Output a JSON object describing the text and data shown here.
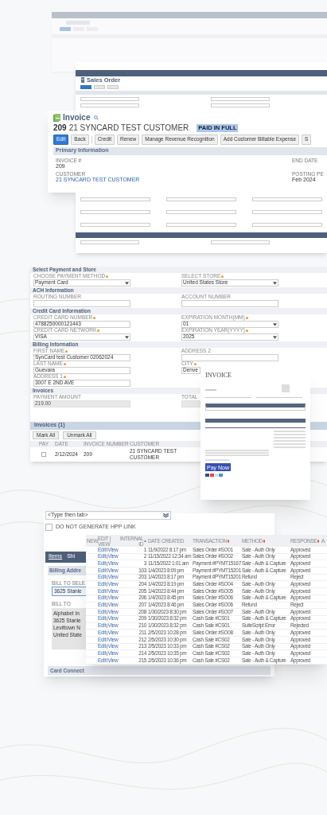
{
  "sales_order": {
    "title": "Sales Order"
  },
  "invoice": {
    "title": "Invoice",
    "number": "209",
    "customer": "21 SYNCARD TEST CUSTOMER",
    "status": "PAID IN FULL",
    "buttons": [
      {
        "label": "Edit",
        "primary": true
      },
      {
        "label": "Back",
        "primary": false
      },
      {
        "label": "Credit",
        "primary": false
      },
      {
        "label": "Renew",
        "primary": false
      },
      {
        "label": "Manage Revenue Recognition",
        "primary": false
      },
      {
        "label": "Add Customer Billable Expense",
        "primary": false
      },
      {
        "label": "S",
        "primary": false
      }
    ],
    "section": "Primary Information",
    "fields": [
      {
        "label": "INVOICE #",
        "value": "209",
        "link": false
      },
      {
        "label": "END DATE"
      },
      {
        "label": "CUSTOMER",
        "value": "21 SYNCARD TEST CUSTOMER",
        "link": true
      },
      {
        "label": "POSTING PE",
        "value": "Feb 2024",
        "link": false
      }
    ]
  },
  "payment_form": {
    "sections": [
      {
        "title": "Select Payment and Store",
        "fields": [
          {
            "label": "CHOOSE PAYMENT METHOD",
            "required": true,
            "value": "Payment Card",
            "kind": "select"
          },
          {
            "label": "SELECT STORE",
            "required": true,
            "value": "United States Store",
            "kind": "select"
          }
        ]
      },
      {
        "title": "ACH Information",
        "fields": [
          {
            "label": "ROUTING NUMBER",
            "required": false,
            "kind": "input"
          },
          {
            "label": "ACCOUNT NUMBER",
            "required": false,
            "kind": "input"
          }
        ]
      },
      {
        "title": "Credit Card Information",
        "fields": [
          {
            "label": "CREDIT CARD NUMBER",
            "required": true,
            "value": "4788250000121443",
            "kind": "input"
          },
          {
            "label": "EXPIRATION MONTH(MM)",
            "required": true,
            "value": "01",
            "kind": "select"
          },
          {
            "label": "CREDIT CARD NETWORK",
            "required": true,
            "value": "VISA",
            "kind": "select"
          },
          {
            "label": "EXPIRATION YEAR(YYYY)",
            "required": true,
            "value": "2025",
            "kind": "select"
          }
        ]
      },
      {
        "title": "Billing Information",
        "fields": [
          {
            "label": "FIRST NAME",
            "required": true,
            "value": "SynCard test Customer 02062024",
            "kind": "input"
          },
          {
            "label": "ADDRESS 2",
            "required": false,
            "kind": "input"
          },
          {
            "label": "LAST NAME",
            "required": true,
            "value": "Guevara",
            "kind": "input"
          },
          {
            "label": "CITY",
            "required": true,
            "value": "Denve",
            "kind": "input"
          },
          {
            "label": "ADDRESS 1",
            "required": true,
            "value": "3007 E 2ND AVE",
            "kind": "input"
          }
        ]
      },
      {
        "title": "Invoices",
        "fields": [
          {
            "label": "PAYMENT AMOUNT",
            "required": false,
            "value": "219.00",
            "kind": "disabled"
          },
          {
            "label": "TOTAL",
            "kind": "disabled"
          }
        ]
      }
    ],
    "invoices": {
      "title": "Invoices (1)",
      "buttons": [
        "Mark All",
        "Unmark All"
      ],
      "columns": [
        "PAY",
        "DATE",
        "INVOICE NUMBER",
        "CUSTOMER"
      ],
      "rows": [
        {
          "checked": false,
          "cells": [
            null,
            "2/12/2024",
            "209",
            "21 SYNCARD TEST CUSTOMER"
          ]
        }
      ]
    }
  },
  "invoice_document": {
    "title": "INVOICE",
    "pay_button": "Pay Now"
  },
  "bottom_form": {
    "select_placeholder": "<Type then tab>",
    "checkbox": {
      "label": "DO NOT GENERATE HPP LINK",
      "checked": false
    },
    "tabs": [
      {
        "label": "Items",
        "selected": true
      },
      {
        "label": "Shi",
        "selected": false
      }
    ],
    "section": "Billing Addre",
    "bill_to_select_label": "BILL TO SELE",
    "bill_to_select_value": "3625 Stanle",
    "bill_to_label": "BILL TO",
    "bill_to_lines": [
      "Alphabet In",
      "3625 Stanle",
      "Levittown N",
      "United State"
    ],
    "footer_section": "Card Connect"
  },
  "log_table": {
    "columns": [
      "NEW",
      "EDIT | VIEW",
      "INTERNAL ID",
      "DATE CREATED",
      "TRANSACTION",
      "METHOD",
      "RESPONSE",
      "A"
    ],
    "rows": [
      {
        "cells": [
          null,
          {
            "links": [
              "Edit",
              "View"
            ]
          },
          "1",
          "11/9/2022 8:17 pm",
          "Sales Order #SO01",
          "Sale - Auth Only",
          "Approved"
        ]
      },
      {
        "cells": [
          null,
          {
            "links": [
              "Edit",
              "View"
            ]
          },
          "2",
          "11/15/2022 12:34 am",
          "Sales Order #SO02",
          "Sale - Auth Only",
          "Approved"
        ]
      },
      {
        "cells": [
          null,
          {
            "links": [
              "Edit",
              "View"
            ]
          },
          "3",
          "11/15/2022 1:01 am",
          "Payment #PYMT15167",
          "Sale - Auth & Capture",
          "Approved"
        ]
      },
      {
        "cells": [
          null,
          {
            "links": [
              "Edit",
              "View"
            ]
          },
          "103",
          "1/4/2023 8:09 pm",
          "Payment #PYMT15201",
          "Sale - Auth & Capture",
          "Approved"
        ]
      },
      {
        "cells": [
          null,
          {
            "links": [
              "Edit",
              "View"
            ]
          },
          "203",
          "1/4/2023 8:17 pm",
          "Payment #PYMT15201",
          "Refund",
          "Reject"
        ]
      },
      {
        "cells": [
          null,
          {
            "links": [
              "Edit",
              "View"
            ]
          },
          "204",
          "1/4/2023 8:19 pm",
          "Sales Order #SO04",
          "Sale - Auth Only",
          "Approved"
        ]
      },
      {
        "cells": [
          null,
          {
            "links": [
              "Edit",
              "View"
            ]
          },
          "205",
          "1/4/2023 8:44 pm",
          "Sales Order #SO05",
          "Sale - Auth Only",
          "Approved"
        ]
      },
      {
        "cells": [
          null,
          {
            "links": [
              "Edit",
              "View"
            ]
          },
          "206",
          "1/4/2023 8:45 pm",
          "Sales Order #SO06",
          "Sale - Auth & Capture",
          "Approved"
        ]
      },
      {
        "cells": [
          null,
          {
            "links": [
              "Edit",
              "View"
            ]
          },
          "207",
          "1/4/2023 8:46 pm",
          "Sales Order #SO06",
          "Refund",
          "Reject"
        ]
      },
      {
        "cells": [
          null,
          {
            "links": [
              "Edit",
              "View"
            ]
          },
          "208",
          "1/30/2023 8:30 pm",
          "Sales Order #SO07",
          "Sale - Auth Only",
          "Approved"
        ]
      },
      {
        "cells": [
          null,
          {
            "links": [
              "Edit",
              "View"
            ]
          },
          "209",
          "1/30/2023 8:32 pm",
          "Cash Sale #CS01",
          "Sale - Auth & Capture",
          "Approved"
        ]
      },
      {
        "cells": [
          null,
          {
            "links": [
              "Edit",
              "View"
            ]
          },
          "210",
          "1/30/2023 8:32 pm",
          "Cash Sale #CS01",
          "SuiteScript Error",
          "Rejected"
        ]
      },
      {
        "cells": [
          null,
          {
            "links": [
              "Edit",
              "View"
            ]
          },
          "211",
          "2/5/2023 10:28 pm",
          "Sales Order #SO08",
          "Sale - Auth Only",
          "Approved"
        ]
      },
      {
        "cells": [
          null,
          {
            "links": [
              "Edit",
              "View"
            ]
          },
          "212",
          "2/5/2023 10:30 pm",
          "Cash Sale #CS02",
          "Sale - Auth Only",
          "Approved"
        ]
      },
      {
        "cells": [
          null,
          {
            "links": [
              "Edit",
              "View"
            ]
          },
          "213",
          "2/5/2023 10:33 pm",
          "Cash Sale #CS02",
          "Sale - Auth Only",
          "Approved"
        ]
      },
      {
        "cells": [
          null,
          {
            "links": [
              "Edit",
              "View"
            ]
          },
          "214",
          "2/5/2023 10:35 pm",
          "Cash Sale #CS02",
          "Sale - Auth Only",
          "Approved"
        ]
      },
      {
        "cells": [
          null,
          {
            "links": [
              "Edit",
              "View"
            ]
          },
          "215",
          "2/5/2023 10:36 pm",
          "Cash Sale #CS02",
          "Sale - Auth & Capture",
          "Approved"
        ]
      }
    ]
  }
}
